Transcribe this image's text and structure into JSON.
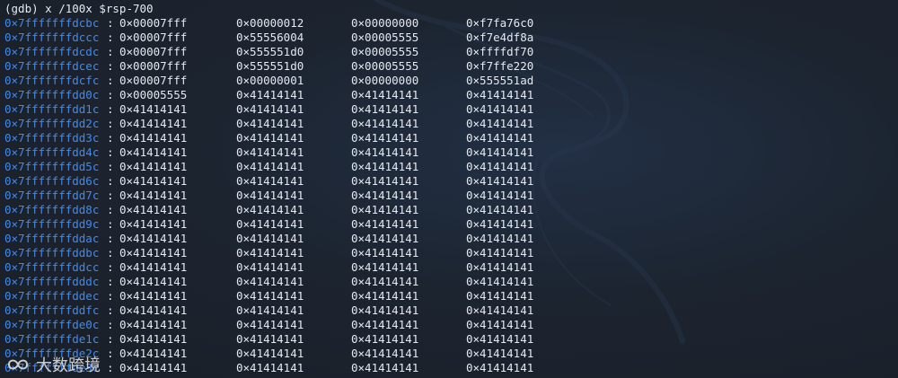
{
  "command": "(gdb) x /100x $rsp-700",
  "rows": [
    {
      "addr": "0×7fffffffdcbc",
      "v": [
        "0×00007fff",
        "0×00000012",
        "0×00000000",
        "0×f7fa76c0"
      ]
    },
    {
      "addr": "0×7fffffffdccc",
      "v": [
        "0×00007fff",
        "0×55556004",
        "0×00005555",
        "0×f7e4df8a"
      ]
    },
    {
      "addr": "0×7fffffffdcdc",
      "v": [
        "0×00007fff",
        "0×555551d0",
        "0×00005555",
        "0×ffffdf70"
      ]
    },
    {
      "addr": "0×7fffffffdcec",
      "v": [
        "0×00007fff",
        "0×555551d0",
        "0×00005555",
        "0×f7ffe220"
      ]
    },
    {
      "addr": "0×7fffffffdcfc",
      "v": [
        "0×00007fff",
        "0×00000001",
        "0×00000000",
        "0×555551ad"
      ]
    },
    {
      "addr": "0×7fffffffdd0c",
      "v": [
        "0×00005555",
        "0×41414141",
        "0×41414141",
        "0×41414141"
      ]
    },
    {
      "addr": "0×7fffffffdd1c",
      "v": [
        "0×41414141",
        "0×41414141",
        "0×41414141",
        "0×41414141"
      ]
    },
    {
      "addr": "0×7fffffffdd2c",
      "v": [
        "0×41414141",
        "0×41414141",
        "0×41414141",
        "0×41414141"
      ]
    },
    {
      "addr": "0×7fffffffdd3c",
      "v": [
        "0×41414141",
        "0×41414141",
        "0×41414141",
        "0×41414141"
      ]
    },
    {
      "addr": "0×7fffffffdd4c",
      "v": [
        "0×41414141",
        "0×41414141",
        "0×41414141",
        "0×41414141"
      ]
    },
    {
      "addr": "0×7fffffffdd5c",
      "v": [
        "0×41414141",
        "0×41414141",
        "0×41414141",
        "0×41414141"
      ]
    },
    {
      "addr": "0×7fffffffdd6c",
      "v": [
        "0×41414141",
        "0×41414141",
        "0×41414141",
        "0×41414141"
      ]
    },
    {
      "addr": "0×7fffffffdd7c",
      "v": [
        "0×41414141",
        "0×41414141",
        "0×41414141",
        "0×41414141"
      ]
    },
    {
      "addr": "0×7fffffffdd8c",
      "v": [
        "0×41414141",
        "0×41414141",
        "0×41414141",
        "0×41414141"
      ]
    },
    {
      "addr": "0×7fffffffdd9c",
      "v": [
        "0×41414141",
        "0×41414141",
        "0×41414141",
        "0×41414141"
      ]
    },
    {
      "addr": "0×7fffffffddac",
      "v": [
        "0×41414141",
        "0×41414141",
        "0×41414141",
        "0×41414141"
      ]
    },
    {
      "addr": "0×7fffffffddbc",
      "v": [
        "0×41414141",
        "0×41414141",
        "0×41414141",
        "0×41414141"
      ]
    },
    {
      "addr": "0×7fffffffddcc",
      "v": [
        "0×41414141",
        "0×41414141",
        "0×41414141",
        "0×41414141"
      ]
    },
    {
      "addr": "0×7fffffffdddc",
      "v": [
        "0×41414141",
        "0×41414141",
        "0×41414141",
        "0×41414141"
      ]
    },
    {
      "addr": "0×7fffffffddec",
      "v": [
        "0×41414141",
        "0×41414141",
        "0×41414141",
        "0×41414141"
      ]
    },
    {
      "addr": "0×7fffffffddfc",
      "v": [
        "0×41414141",
        "0×41414141",
        "0×41414141",
        "0×41414141"
      ]
    },
    {
      "addr": "0×7fffffffde0c",
      "v": [
        "0×41414141",
        "0×41414141",
        "0×41414141",
        "0×41414141"
      ]
    },
    {
      "addr": "0×7fffffffde1c",
      "v": [
        "0×41414141",
        "0×41414141",
        "0×41414141",
        "0×41414141"
      ]
    },
    {
      "addr": "0×7fffffffde2c",
      "v": [
        "0×41414141",
        "0×41414141",
        "0×41414141",
        "0×41414141"
      ]
    },
    {
      "addr": "0×7fffffffde3c",
      "v": [
        "0×41414141",
        "0×41414141",
        "0×41414141",
        "0×41414141"
      ]
    }
  ],
  "watermark": {
    "text": "大数跨境",
    "icon": "infinity-logo-icon"
  },
  "colors": {
    "background": "#1c222c",
    "address": "#3d8bf5",
    "text": "#e6e9ef"
  }
}
